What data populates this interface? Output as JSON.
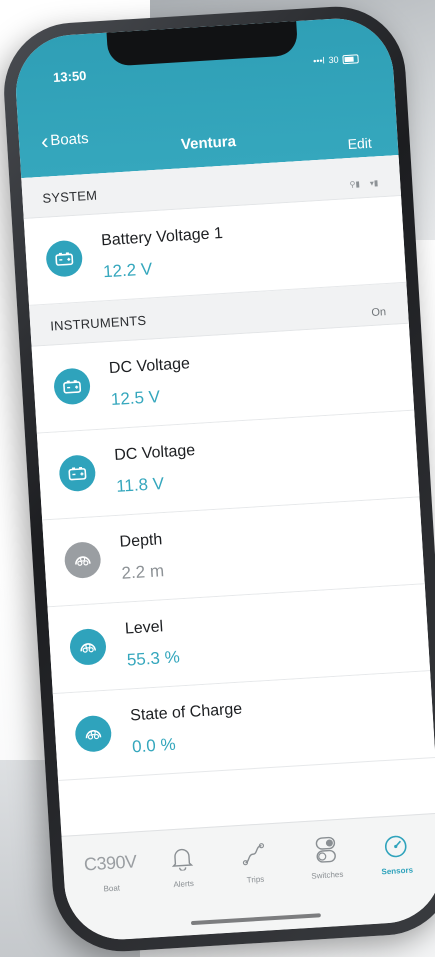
{
  "status_bar": {
    "time": "13:50",
    "signal": "•••l",
    "network": "30"
  },
  "nav": {
    "back_label": "Boats",
    "title": "Ventura",
    "edit_label": "Edit"
  },
  "sections": {
    "system": {
      "title": "SYSTEM",
      "right_icons": [
        "location-signal-icon",
        "signal-icon"
      ]
    },
    "instruments": {
      "title": "INSTRUMENTS",
      "right_label": "On"
    }
  },
  "rows": [
    {
      "name": "Battery Voltage 1",
      "value": "12.2 V",
      "icon": "battery-icon",
      "accent": true
    },
    {
      "name": "DC Voltage",
      "value": "12.5 V",
      "icon": "battery-icon",
      "accent": true
    },
    {
      "name": "DC Voltage",
      "value": "11.8 V",
      "icon": "battery-icon",
      "accent": true
    },
    {
      "name": "Depth",
      "value": "2.2 m",
      "icon": "gauge-icon",
      "accent": false
    },
    {
      "name": "Level",
      "value": "55.3 %",
      "icon": "gauge-icon",
      "accent": true
    },
    {
      "name": "State of Charge",
      "value": "0.0 %",
      "icon": "gauge-icon",
      "accent": true
    }
  ],
  "tabbar": {
    "boat_model": "C390V",
    "boat_label": "Boat",
    "alerts_label": "Alerts",
    "trips_label": "Trips",
    "switches_label": "Switches",
    "sensors_label": "Sensors"
  },
  "colors": {
    "accent": "#35a7bd",
    "header": "#2f9fb6",
    "inactive": "#9a9ea2"
  }
}
